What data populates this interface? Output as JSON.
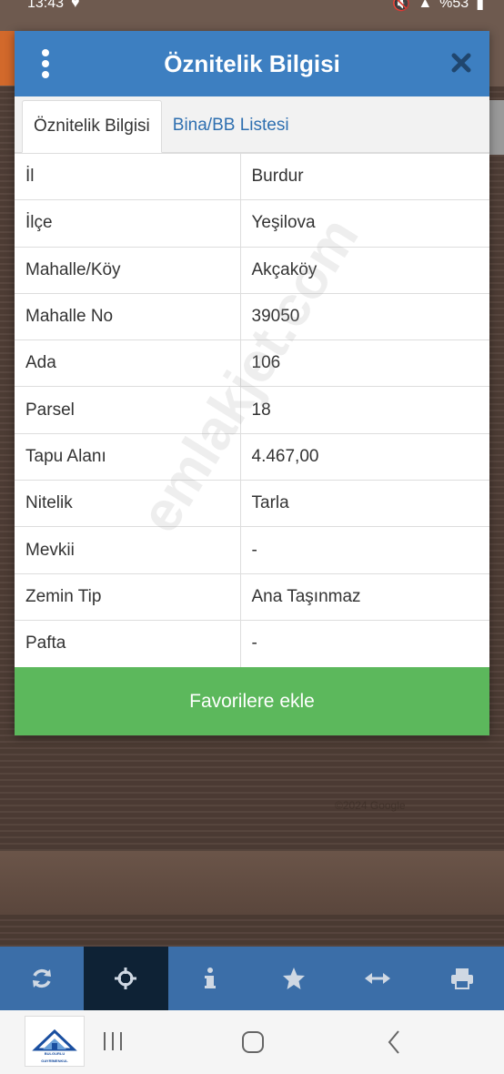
{
  "status_bar": {
    "time": "13:43",
    "battery": "%53"
  },
  "dialog": {
    "title": "Öznitelik Bilgisi",
    "tabs": [
      {
        "label": "Öznitelik Bilgisi",
        "active": true
      },
      {
        "label": "Bina/BB Listesi",
        "active": false
      }
    ],
    "rows": [
      {
        "key": "İl",
        "value": "Burdur"
      },
      {
        "key": "İlçe",
        "value": "Yeşilova"
      },
      {
        "key": "Mahalle/Köy",
        "value": "Akçaköy"
      },
      {
        "key": "Mahalle No",
        "value": "39050"
      },
      {
        "key": "Ada",
        "value": "106"
      },
      {
        "key": "Parsel",
        "value": "18"
      },
      {
        "key": "Tapu Alanı",
        "value": "4.467,00"
      },
      {
        "key": "Nitelik",
        "value": "Tarla"
      },
      {
        "key": "Mevkii",
        "value": "-"
      },
      {
        "key": "Zemin Tip",
        "value": "Ana Taşınmaz"
      },
      {
        "key": "Pafta",
        "value": "-"
      }
    ],
    "favorite_button": "Favorilere ekle"
  },
  "watermark": "emlakjet.com",
  "map_copyright": "©2024 Google",
  "toolbar": {
    "items": [
      "refresh-icon",
      "crosshair-icon",
      "info-icon",
      "star-icon",
      "measure-icon",
      "print-icon"
    ],
    "active": "crosshair-icon"
  },
  "app_thumbnail": {
    "text_line1": "BULGURLU",
    "text_line2": "GAYRİMENKUL"
  },
  "colors": {
    "header_blue": "#3d7fc1",
    "tab_link_blue": "#2e6fb0",
    "favorite_green": "#5cb85c",
    "toolbar_blue": "#3b6ea8",
    "toolbar_active": "#0e2235"
  }
}
